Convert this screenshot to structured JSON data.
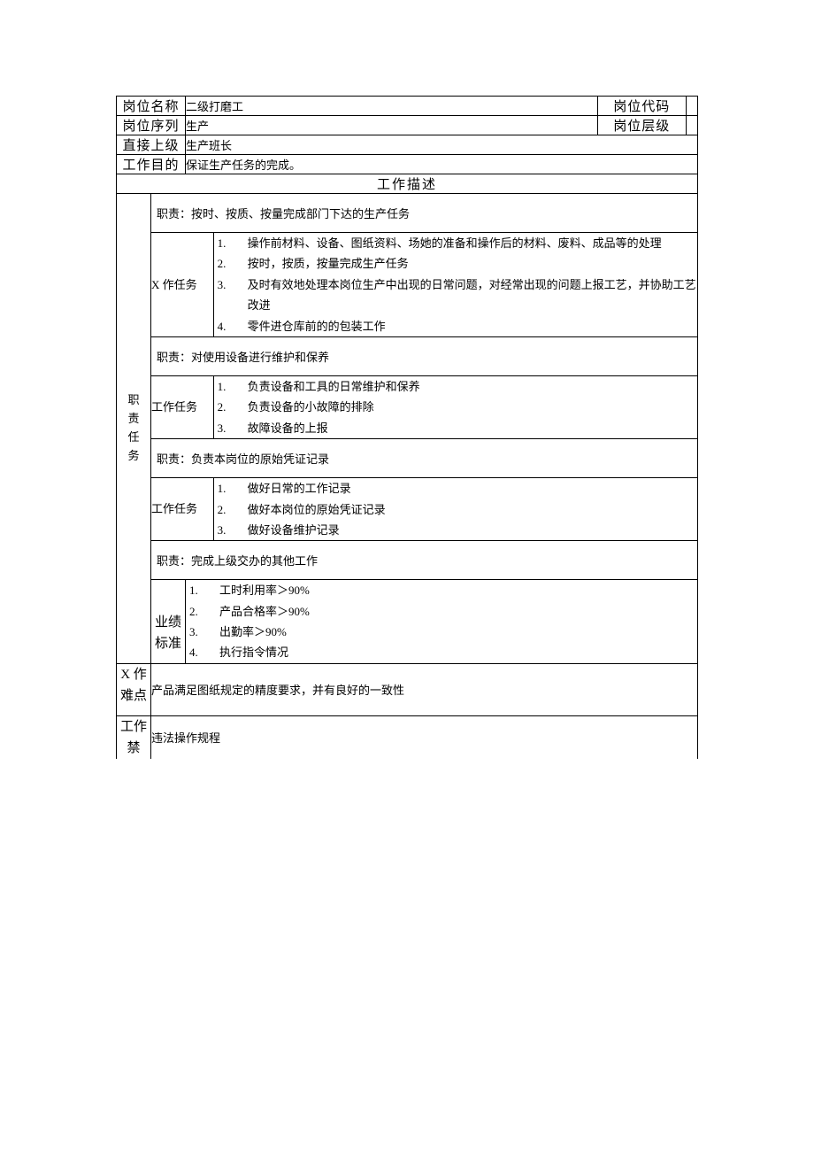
{
  "header": {
    "pos_name_label": "岗位名称",
    "pos_name_value": "二级打磨工",
    "pos_code_label": "岗位代码",
    "pos_code_value": "",
    "pos_series_label": "岗位序列",
    "pos_series_value": "生产",
    "pos_level_label": "岗位层级",
    "pos_level_value": "",
    "supervisor_label": "直接上级",
    "supervisor_value": "生产班长",
    "purpose_label": "工作目的",
    "purpose_value": "保证生产任务的完成。"
  },
  "desc_title": "工作描述",
  "duties_label": "职 责 任 务",
  "duty1": {
    "title": "职责：按时、按质、按量完成部门下达的生产任务",
    "task_label": "X 作任务",
    "items": [
      "操作前材料、设备、图纸资料、场她的准备和操作后的材料、废料、成品等的处理",
      "按时，按质，按量完成生产任务",
      "及时有效地处理本岗位生产中出现的日常问题，对经常出现的问题上报工艺，并协助工艺改进",
      "零件进仓库前的的包装工作"
    ]
  },
  "duty2": {
    "title": "职责：对使用设备进行维护和保养",
    "task_label": "工作任务",
    "items": [
      "负责设备和工具的日常维护和保养",
      "负责设备的小故障的排除",
      "故障设备的上报"
    ]
  },
  "duty3": {
    "title": "职责：负责本岗位的原始凭证记录",
    "task_label": "工作任务",
    "items": [
      "做好日常的工作记录",
      "做好本岗位的原始凭证记录",
      "做好设备维护记录"
    ]
  },
  "duty4": {
    "title": "职责：完成上级交办的其他工作"
  },
  "perf": {
    "label": "业绩标准",
    "items": [
      "工时利用率＞90%",
      "产品合格率＞90%",
      "出勤率＞90%",
      "执行指令情况"
    ]
  },
  "difficulty": {
    "label": "X 作难点",
    "text": "产品满足图纸规定的精度要求，并有良好的一致性"
  },
  "forbidden": {
    "label": "工作禁",
    "text": "违法操作规程"
  }
}
